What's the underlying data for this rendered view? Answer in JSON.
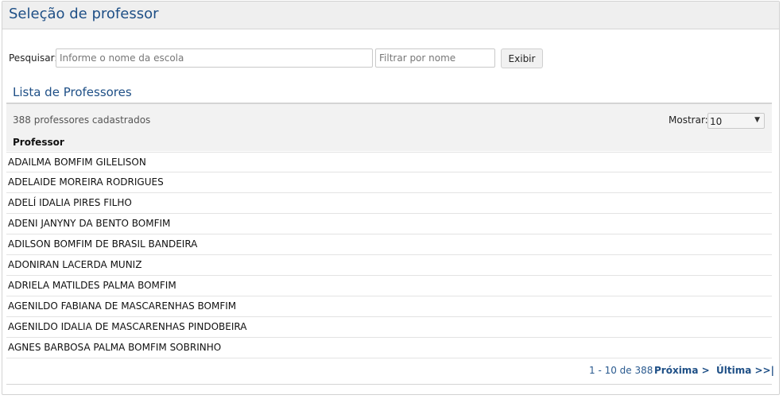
{
  "page": {
    "title": "Seleção de professor"
  },
  "search": {
    "label": "Pesquisar:",
    "school_placeholder": "Informe o nome da escola",
    "name_placeholder": "Filtrar por nome",
    "button_label": "Exibir"
  },
  "list": {
    "title": "Lista de Professores",
    "count_text": "388 professores cadastrados",
    "show_label": "Mostrar:",
    "show_value": "10",
    "column_header": "Professor",
    "rows": [
      "ADAILMA BOMFIM GILELISON",
      "ADELAIDE MOREIRA RODRIGUES",
      "ADELÍ IDALIA PIRES FILHO",
      "ADENI JANYNY DA BENTO BOMFIM",
      "ADILSON BOMFIM DE BRASIL BANDEIRA",
      "ADONIRAN LACERDA MUNIZ",
      "ADRIELA MATILDES PALMA BOMFIM",
      "AGENILDO FABIANA DE MASCARENHAS BOMFIM",
      "AGENILDO IDALIA DE MASCARENHAS PINDOBEIRA",
      "AGNES BARBOSA PALMA BOMFIM SOBRINHO"
    ]
  },
  "pagination": {
    "range_text": "1 - 10 de 388",
    "next_label": "Próxima >",
    "last_label": "Última >>|"
  },
  "icons": {
    "select_arrow": "chevron-down-icon"
  }
}
